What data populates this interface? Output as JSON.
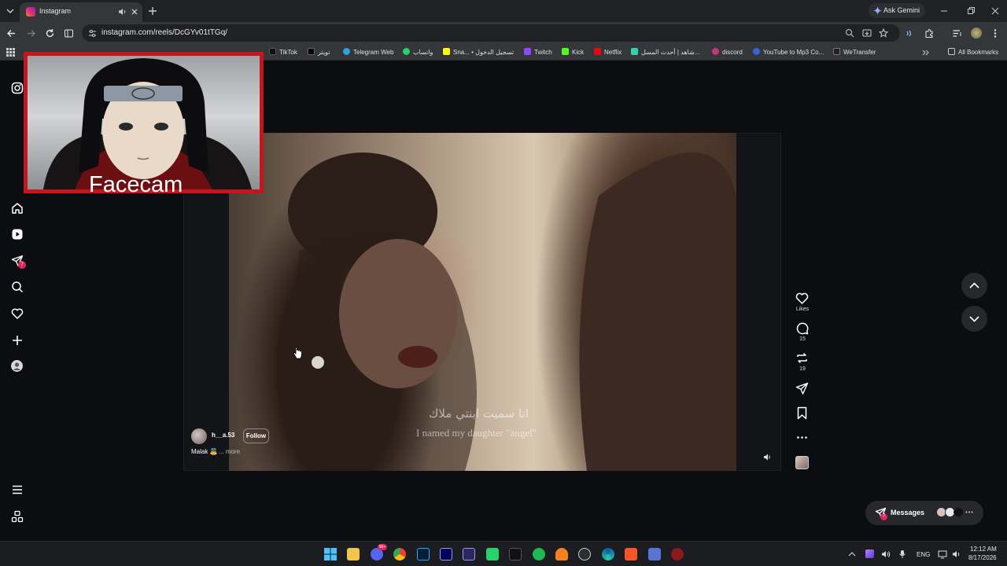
{
  "browser": {
    "tab_title": "Instagram",
    "ask_gemini_label": "Ask Gemini",
    "url": "instagram.com/reels/DcGYv01tTGq/"
  },
  "bookmarks": {
    "items": [
      "TikTok",
      "تويتر",
      "Telegram Web",
      "واتساب",
      "Sna... • تسجيل الدخول",
      "Twitch",
      "Kick",
      "Netflix",
      "شاهد | أحدث المسل...",
      "discord",
      "YouTube to Mp3 Co...",
      "WeTransfer"
    ],
    "all_bookmarks": "All Bookmarks"
  },
  "sidebar": {
    "notification_badge": "7"
  },
  "reel": {
    "username": "h__a.53",
    "follow_label": "Follow",
    "caption": "Malak 👼",
    "more_label": "... more",
    "subtitle_arabic": "انا سميت ابنتي ملاك",
    "subtitle_english": "I named my daughter \"angel\""
  },
  "actions": {
    "likes_label": "Likes",
    "comments_count": "15",
    "reposts_count": "19"
  },
  "messages": {
    "label": "Messages",
    "badge": "7"
  },
  "facecam": {
    "label": "Facecam"
  },
  "taskbar": {
    "language": "ENG",
    "time": "12:12 AM",
    "date": "8/17/2026",
    "discord_badge": "99+"
  },
  "colors": {
    "accent_red": "#c4161c",
    "page_bg": "#0b0d10",
    "badge_red": "#e0245e"
  }
}
